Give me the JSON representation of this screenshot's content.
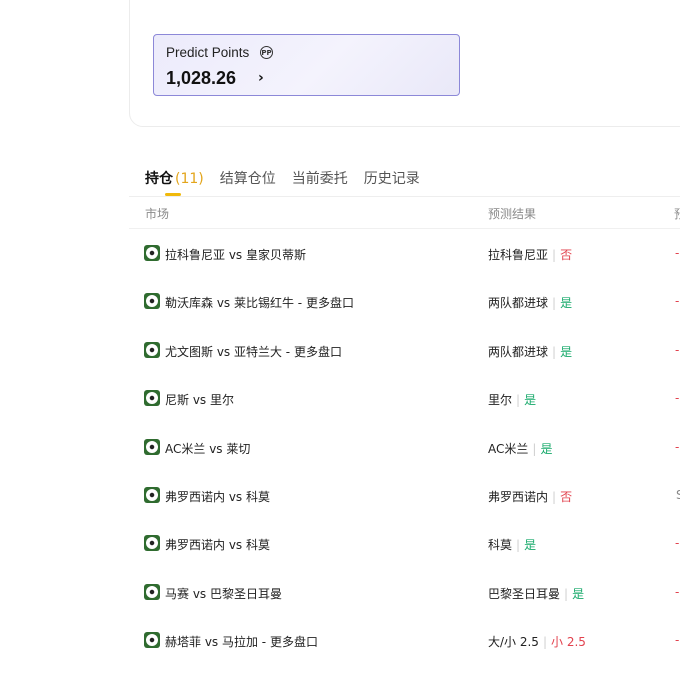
{
  "top_card": {
    "faded_text": "·  ·  ·  ·  ·  ·  ·  ·  ·  ·  ·  ·  ·  ·  ·  ·  ·  ·  ·",
    "points_label": "Predict Points",
    "points_icon": "PP",
    "points_value": "1,028.26",
    "points_chevron": "›"
  },
  "tabs": [
    {
      "label": "持仓",
      "count": "(11)"
    },
    {
      "label": "结算仓位"
    },
    {
      "label": "当前委托"
    },
    {
      "label": "历史记录"
    }
  ],
  "table": {
    "headers": {
      "market": "市场",
      "result": "预测结果",
      "extra": "预"
    },
    "rows": [
      {
        "market": "拉科鲁尼亚 vs 皇家贝蒂斯",
        "pick": "拉科鲁尼亚",
        "outcome": "否",
        "outcome_type": "no",
        "edge": "-"
      },
      {
        "market": "勒沃库森 vs 莱比锡红牛 - 更多盘口",
        "pick": "两队都进球",
        "outcome": "是",
        "outcome_type": "yes",
        "edge": "-"
      },
      {
        "market": "尤文图斯 vs 亚特兰大 - 更多盘口",
        "pick": "两队都进球",
        "outcome": "是",
        "outcome_type": "yes",
        "edge": "-"
      },
      {
        "market": "尼斯 vs 里尔",
        "pick": "里尔",
        "outcome": "是",
        "outcome_type": "yes",
        "edge": "-"
      },
      {
        "market": "AC米兰 vs 莱切",
        "pick": "AC米兰",
        "outcome": "是",
        "outcome_type": "yes",
        "edge": "-"
      },
      {
        "market": "弗罗西诺内 vs 科莫",
        "pick": "弗罗西诺内",
        "outcome": "否",
        "outcome_type": "no",
        "edge": "S"
      },
      {
        "market": "弗罗西诺内 vs 科莫",
        "pick": "科莫",
        "outcome": "是",
        "outcome_type": "yes",
        "edge": "-"
      },
      {
        "market": "马赛 vs 巴黎圣日耳曼",
        "pick": "巴黎圣日耳曼",
        "outcome": "是",
        "outcome_type": "yes",
        "edge": "-"
      },
      {
        "market": "赫塔菲 vs 马拉加 - 更多盘口",
        "pick": "大/小 2.5",
        "outcome": "小 2.5",
        "outcome_type": "no",
        "edge": "-"
      }
    ]
  }
}
